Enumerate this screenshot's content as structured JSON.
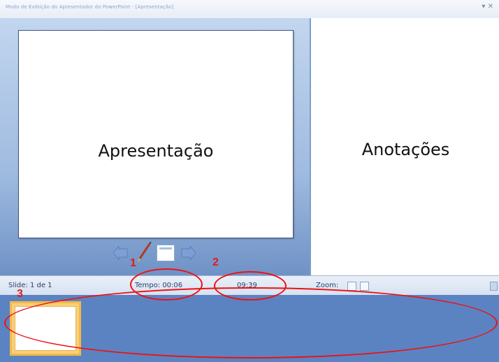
{
  "window": {
    "title": "Modo de Exibição do Apresentador do PowerPoint - [Apresentação]",
    "controls": "▾ ✕"
  },
  "slide_pane": {
    "slide_text": "Apresentação"
  },
  "notes_pane": {
    "notes_text": "Anotações"
  },
  "navbar": {
    "prev_icon": "left-arrow-icon",
    "pen_icon": "pen-icon",
    "menu_icon": "slide-menu-icon",
    "next_icon": "right-arrow-icon"
  },
  "status": {
    "slide_label": "Slide: 1 de 1",
    "tempo_label": "Tempo: 00:06",
    "clock": "09:39",
    "zoom_label": "Zoom:"
  },
  "annotations": {
    "one": "1",
    "two": "2",
    "three": "3"
  },
  "colors": {
    "accent_blue": "#5b83c2",
    "annotation_red": "#e11111",
    "thumbnail_border": "#f3b84a"
  }
}
